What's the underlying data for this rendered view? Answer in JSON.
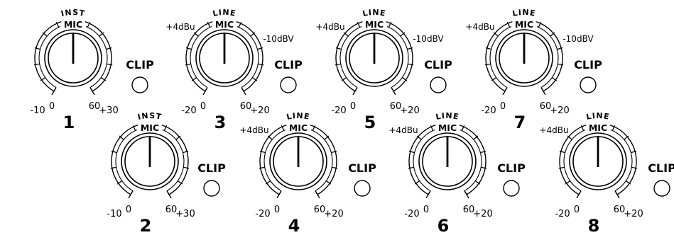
{
  "channels": [
    {
      "number": "1",
      "arc_label": "INST",
      "mic_label": "MIC",
      "left_ref": "",
      "right_ref": "",
      "min_label": "-10",
      "zero_label": "0",
      "mid_label": "60",
      "max_label": "+30",
      "clip_label": "CLIP"
    },
    {
      "number": "2",
      "arc_label": "INST",
      "mic_label": "MIC",
      "left_ref": "",
      "right_ref": "",
      "min_label": "-10",
      "zero_label": "0",
      "mid_label": "60",
      "max_label": "+30",
      "clip_label": "CLIP"
    },
    {
      "number": "3",
      "arc_label": "LINE",
      "mic_label": "MIC",
      "left_ref": "+4dBu",
      "right_ref": "-10dBV",
      "min_label": "-20",
      "zero_label": "0",
      "mid_label": "60",
      "max_label": "+20",
      "clip_label": "CLIP"
    },
    {
      "number": "4",
      "arc_label": "LINE",
      "mic_label": "MIC",
      "left_ref": "+4dBu",
      "right_ref": "",
      "min_label": "-20",
      "zero_label": "0",
      "mid_label": "60",
      "max_label": "+20",
      "clip_label": "CLIP"
    },
    {
      "number": "5",
      "arc_label": "LINE",
      "mic_label": "MIC",
      "left_ref": "+4dBu",
      "right_ref": "-10dBV",
      "min_label": "-20",
      "zero_label": "0",
      "mid_label": "60",
      "max_label": "+20",
      "clip_label": "CLIP"
    },
    {
      "number": "6",
      "arc_label": "LINE",
      "mic_label": "MIC",
      "left_ref": "+4dBu",
      "right_ref": "",
      "min_label": "-20",
      "zero_label": "0",
      "mid_label": "60",
      "max_label": "+20",
      "clip_label": "CLIP"
    },
    {
      "number": "7",
      "arc_label": "LINE",
      "mic_label": "MIC",
      "left_ref": "+4dBu",
      "right_ref": "-10dBV",
      "min_label": "-20",
      "zero_label": "0",
      "mid_label": "60",
      "max_label": "+20",
      "clip_label": "CLIP"
    },
    {
      "number": "8",
      "arc_label": "LINE",
      "mic_label": "MIC",
      "left_ref": "+4dBu",
      "right_ref": "",
      "min_label": "-20",
      "zero_label": "0",
      "mid_label": "60",
      "max_label": "+20",
      "clip_label": "CLIP"
    }
  ]
}
